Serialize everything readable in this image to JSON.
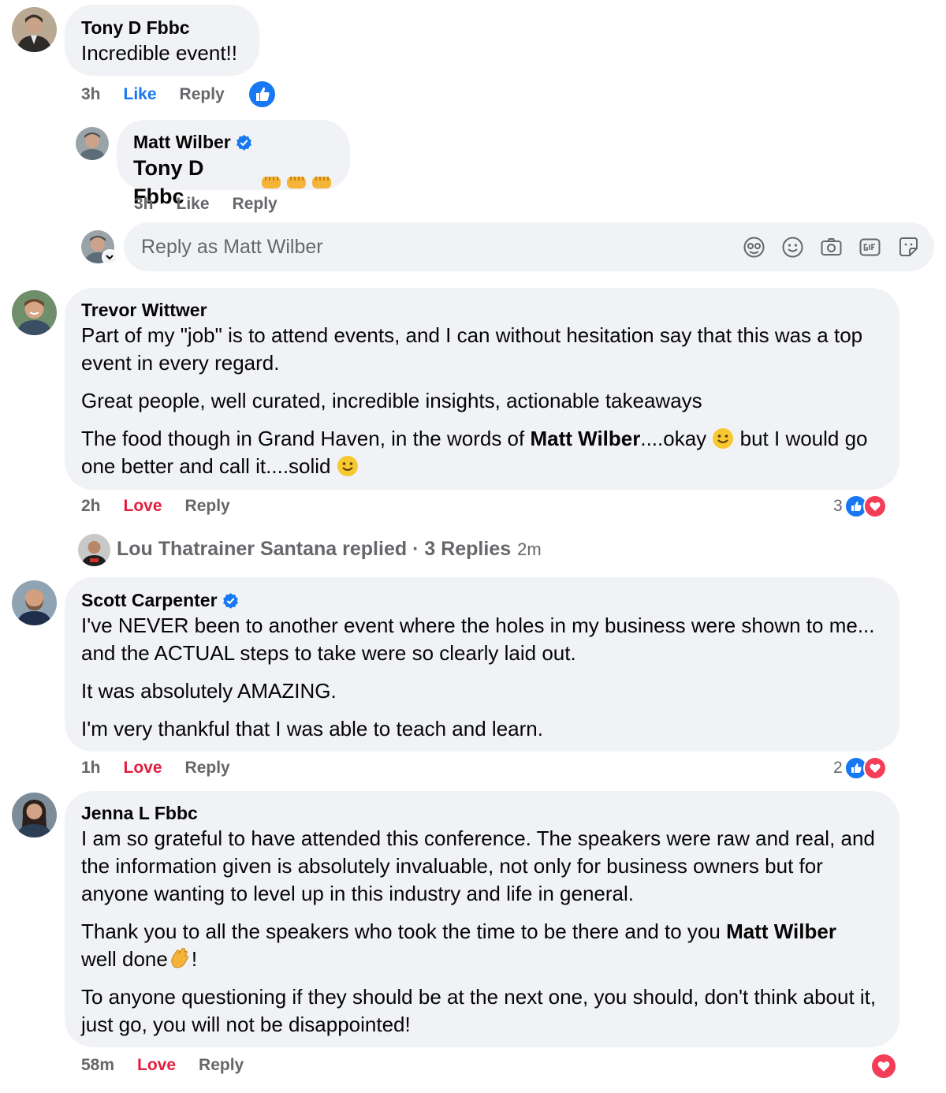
{
  "comments": [
    {
      "author": "Tony D Fbbc",
      "text": "Incredible event!!",
      "time": "3h",
      "actions": [
        "Like",
        "Reply"
      ]
    },
    {
      "author": "Matt Wilber",
      "mention": "Tony D Fbbc",
      "time": "3h",
      "actions": [
        "Like",
        "Reply"
      ]
    },
    {
      "author": "Trevor Wittwer",
      "paragraphs": [
        "Part of my \"job\" is to attend events, and I can without hesitation say that this was a top event in every regard.",
        "Great people, well curated, incredible insights, actionable takeaways"
      ],
      "p3_before": "The food though in Grand Haven, in the words of ",
      "p3_mention": "Matt Wilber",
      "p3_mid": "....okay ",
      "p3_after": " but I would go one better and call it....solid ",
      "time": "2h",
      "actions": [
        "Love",
        "Reply"
      ],
      "reaction_count": "3"
    },
    {
      "author": "Scott Carpenter",
      "paragraphs": [
        "I've NEVER been to another event where the holes in my business were shown to me... and the ACTUAL steps to take were so clearly laid out.",
        "It was absolutely AMAZING.",
        "I'm very thankful that I was able to teach and learn."
      ],
      "time": "1h",
      "actions": [
        "Love",
        "Reply"
      ],
      "reaction_count": "2"
    },
    {
      "author": "Jenna L Fbbc",
      "paragraphs": [
        "I am so grateful to have attended this conference. The speakers were raw and real, and the information given is absolutely invaluable, not only for business owners but for anyone wanting to level up in this industry and life in general.",
        "To anyone questioning if they should be at the next one, you should, don't think about it, just go, you will not be disappointed!"
      ],
      "p2_before": "Thank you to all the speakers who took the time to be there and to you ",
      "p2_mention": "Matt Wilber",
      "p2_after_break": "well done",
      "p2_end": "!",
      "time": "58m",
      "actions": [
        "Love",
        "Reply"
      ]
    }
  ],
  "reply_box": {
    "placeholder": "Reply as Matt Wilber"
  },
  "replied": {
    "label": "Lou Thatrainer Santana replied · 3 Replies",
    "time": "2m"
  },
  "icons": [
    "thumbs-up-icon",
    "verified-badge-icon",
    "fist-emoji",
    "smile-emoji",
    "clap-emoji",
    "avatar-sticker-icon",
    "emoji-icon",
    "camera-icon",
    "gif-icon",
    "sticker-icon",
    "love-heart-icon"
  ],
  "colors": {
    "bubble": "#f0f2f5",
    "like": "#1877f2",
    "love": "#e41e3f",
    "meta": "#65676b"
  }
}
